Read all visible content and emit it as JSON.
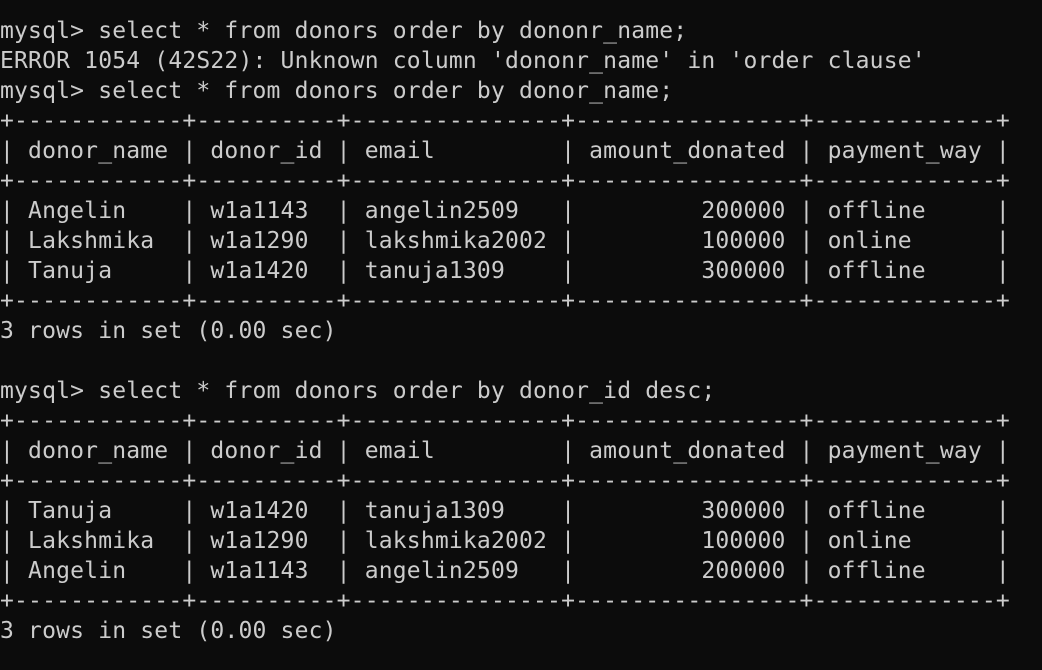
{
  "theme": {
    "background": "#0c0c0c",
    "foreground": "#cccccc"
  },
  "lines": [
    "mysql> select * from donors order by dononr_name;",
    "ERROR 1054 (42S22): Unknown column 'dononr_name' in 'order clause'",
    "mysql> select * from donors order by donor_name;",
    "+------------+----------+---------------+----------------+-------------+",
    "| donor_name | donor_id | email         | amount_donated | payment_way |",
    "+------------+----------+---------------+----------------+-------------+",
    "| Angelin    | w1a1143  | angelin2509   |         200000 | offline     |",
    "| Lakshmika  | w1a1290  | lakshmika2002 |         100000 | online      |",
    "| Tanuja     | w1a1420  | tanuja1309    |         300000 | offline     |",
    "+------------+----------+---------------+----------------+-------------+",
    "3 rows in set (0.00 sec)",
    "",
    "mysql> select * from donors order by donor_id desc;",
    "+------------+----------+---------------+----------------+-------------+",
    "| donor_name | donor_id | email         | amount_donated | payment_way |",
    "+------------+----------+---------------+----------------+-------------+",
    "| Tanuja     | w1a1420  | tanuja1309    |         300000 | offline     |",
    "| Lakshmika  | w1a1290  | lakshmika2002 |         100000 | online      |",
    "| Angelin    | w1a1143  | angelin2509   |         200000 | offline     |",
    "+------------+----------+---------------+----------------+-------------+",
    "3 rows in set (0.00 sec)"
  ]
}
